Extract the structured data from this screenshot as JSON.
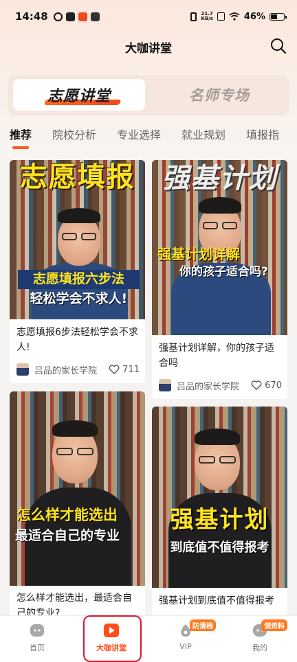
{
  "status": {
    "time": "14:48",
    "net_speed_top": "21.7",
    "net_speed_unit": "KB/s",
    "battery": "46%"
  },
  "header": {
    "title": "大咖讲堂"
  },
  "segment": {
    "active": "志愿讲堂",
    "inactive": "名师专场"
  },
  "tabs": [
    "推荐",
    "院校分析",
    "专业选择",
    "就业规划",
    "填报指"
  ],
  "cards": [
    {
      "banner_top": "志愿填报",
      "banner_mid": "志愿填报六步法",
      "banner_bottom": "轻松学会不求人!",
      "title": "志愿填报6步法轻松学会不求人!",
      "author": "吕品的家长学院",
      "likes": "711"
    },
    {
      "banner_top": "强基计划",
      "banner_mid": "强基计划详解",
      "banner_bottom": "你的孩子适合吗?",
      "title": "强基计划详解，你的孩子适合吗",
      "author": "吕品的家长学院",
      "likes": "670"
    },
    {
      "banner_mid": "怎么样才能选出",
      "banner_bottom": "最适合自己的专业",
      "title": "怎么样才能选出，最适合自己的专业?"
    },
    {
      "banner_mid": "强基计划",
      "banner_bottom": "到底值不值得报考",
      "title": "强基计划到底值不值得报考"
    }
  ],
  "nav": {
    "home": "首页",
    "lecture": "大咖讲堂",
    "vip": "VIP",
    "vip_badge": "防滑档",
    "mine": "我的",
    "mine_badge": "领资料"
  },
  "colors": {
    "accent": "#ff5a1f",
    "highlight": "#e0162b"
  }
}
